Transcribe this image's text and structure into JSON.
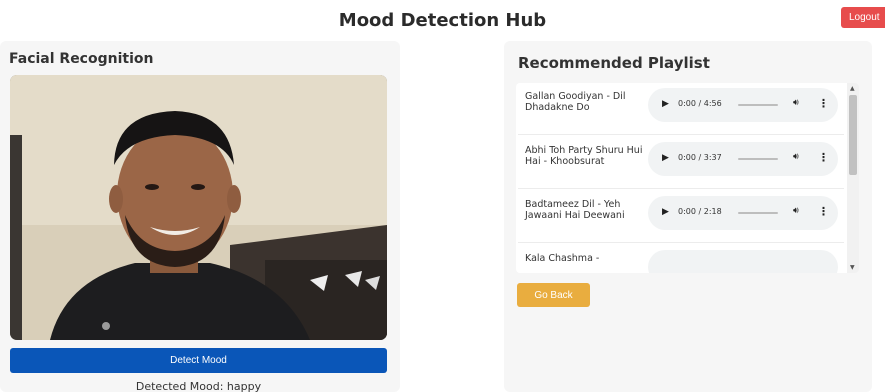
{
  "header": {
    "title": "Mood Detection Hub",
    "logout_label": "Logout"
  },
  "left_panel": {
    "heading": "Facial Recognition",
    "detect_button_label": "Detect Mood",
    "detected_mood_text": "Detected Mood: happy"
  },
  "right_panel": {
    "heading": "Recommended Playlist",
    "tracks": [
      {
        "title": "Gallan Goodiyan - Dil Dhadakne Do",
        "time": "0:00 / 4:56"
      },
      {
        "title": "Abhi Toh Party Shuru Hui Hai - Khoobsurat",
        "time": "0:00 / 3:37"
      },
      {
        "title": "Badtameez Dil - Yeh Jawaani Hai Deewani",
        "time": "0:00 / 2:18"
      },
      {
        "title": "Kala Chashma -",
        "time": ""
      }
    ],
    "go_back_label": "Go Back"
  },
  "colors": {
    "logout": "#e74c4c",
    "detect_button": "#0a56b8",
    "go_back": "#e9ad3f",
    "panel_bg": "#f6f6f6",
    "player_bg": "#f1f3f4"
  },
  "icons": {
    "play": "play-icon",
    "volume": "volume-icon",
    "menu": "more-vertical-icon",
    "scroll_up": "scroll-up-arrow",
    "scroll_down": "scroll-down-arrow"
  }
}
